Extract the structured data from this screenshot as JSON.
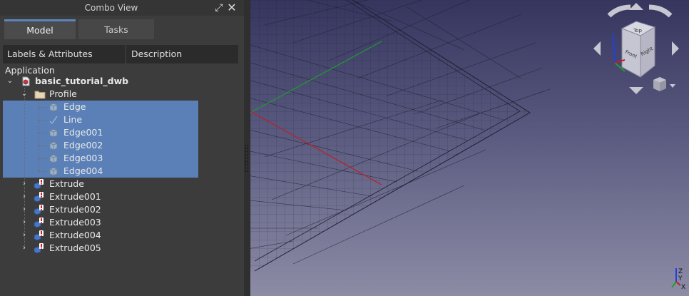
{
  "combo_view": {
    "title": "Combo View",
    "tabs": [
      {
        "label": "Model",
        "active": true
      },
      {
        "label": "Tasks",
        "active": false
      }
    ]
  },
  "tree_header": {
    "col1": "Labels & Attributes",
    "col2": "Description"
  },
  "tree": {
    "root_label": "Application",
    "document": "basic_tutorial_dwb",
    "profile": "Profile",
    "profile_children": [
      "Edge",
      "Line",
      "Edge001",
      "Edge002",
      "Edge003",
      "Edge004"
    ],
    "extrudes": [
      "Extrude",
      "Extrude001",
      "Extrude002",
      "Extrude003",
      "Extrude004",
      "Extrude005"
    ]
  },
  "nav_cube": {
    "faces": [
      "Top",
      "Front",
      "Right"
    ]
  },
  "axis_labels": {
    "x": "X",
    "y": "Y",
    "z": "Z"
  },
  "colors": {
    "selection": "#5a80b7",
    "x_axis": "#cc2020",
    "y_axis": "#20a020",
    "z_axis": "#2040e0",
    "accent": "#5b84bd"
  }
}
